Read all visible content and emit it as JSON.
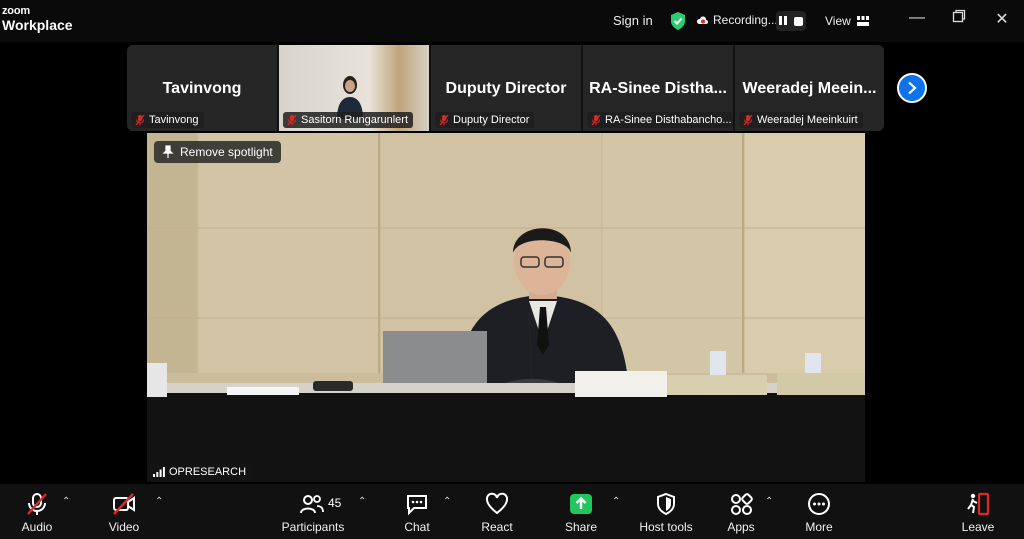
{
  "app": {
    "brand_top": "zoom",
    "brand_bottom": "Workplace"
  },
  "topbar": {
    "signin": "Sign in",
    "recording": "Recording...",
    "view": "View"
  },
  "gallery": [
    {
      "display_name": "Tavinvong",
      "tag": "Tavinvong",
      "has_video": false
    },
    {
      "display_name": "",
      "tag": "Sasitorn Rungarunlert",
      "has_video": true
    },
    {
      "display_name": "Duputy Director",
      "tag": "Duputy Director",
      "has_video": false
    },
    {
      "display_name": "RA-Sinee  Distha...",
      "tag": "RA-Sinee Disthabancho...",
      "has_video": false
    },
    {
      "display_name": "Weeradej  Meein...",
      "tag": "Weeradej Meeinkuirt",
      "has_video": false
    }
  ],
  "main": {
    "remove_spotlight": "Remove spotlight",
    "speaker_tag": "OPRESEARCH"
  },
  "toolbar": {
    "audio": "Audio",
    "video": "Video",
    "participants": "Participants",
    "participants_count": "45",
    "chat": "Chat",
    "react": "React",
    "share": "Share",
    "host_tools": "Host tools",
    "apps": "Apps",
    "more": "More",
    "leave": "Leave"
  },
  "colors": {
    "accent_blue": "#0e72ed",
    "share_green": "#23c55e",
    "muted_red": "#e02828",
    "shield_green": "#2ecc71"
  }
}
